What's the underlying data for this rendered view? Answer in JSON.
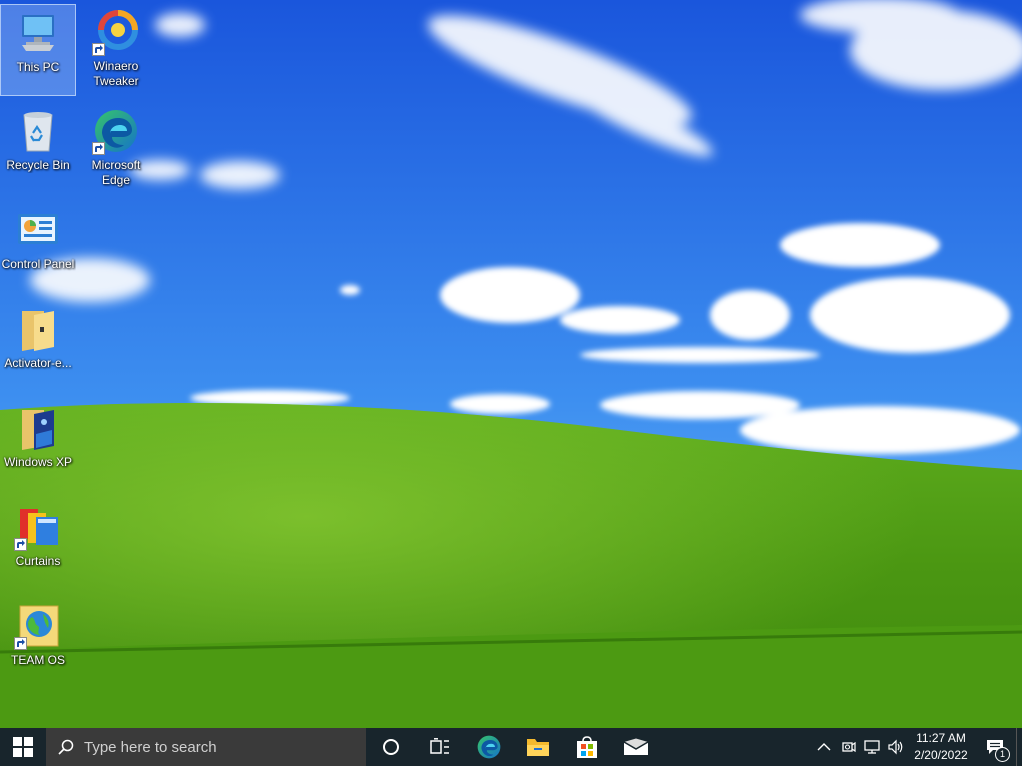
{
  "desktop": {
    "icons": [
      {
        "label": "This PC",
        "icon": "computer-icon",
        "shortcut": false,
        "selected": true
      },
      {
        "label": "Winaero Tweaker",
        "icon": "winaero-tweaker-icon",
        "shortcut": true
      },
      {
        "label": "Recycle Bin",
        "icon": "recycle-bin-icon",
        "shortcut": false
      },
      {
        "label": "Microsoft Edge",
        "icon": "edge-icon",
        "shortcut": true
      },
      {
        "label": "Control Panel",
        "icon": "control-panel-icon",
        "shortcut": false
      },
      {
        "label": "Activator-e...",
        "icon": "folder-icon",
        "shortcut": false
      },
      {
        "label": "Windows XP",
        "icon": "folder-icon",
        "shortcut": false
      },
      {
        "label": "Curtains",
        "icon": "curtains-icon",
        "shortcut": true
      },
      {
        "label": "TEAM OS",
        "icon": "globe-icon",
        "shortcut": true
      }
    ]
  },
  "taskbar": {
    "search_placeholder": "Type here to search",
    "pinned": [
      {
        "name": "cortana",
        "icon": "circle-icon"
      },
      {
        "name": "task-view",
        "icon": "task-view-icon"
      },
      {
        "name": "edge",
        "icon": "edge-icon"
      },
      {
        "name": "file-explorer",
        "icon": "folder-icon"
      },
      {
        "name": "microsoft-store",
        "icon": "store-icon"
      },
      {
        "name": "mail",
        "icon": "mail-icon"
      }
    ],
    "tray": {
      "time": "11:27 AM",
      "date": "2/20/2022",
      "notification_count": "1"
    }
  },
  "colors": {
    "taskbar_bg": "#18252c",
    "search_bg": "#3a3a3a",
    "sky_top": "#1d5fe0",
    "grass": "#5fa81c"
  }
}
